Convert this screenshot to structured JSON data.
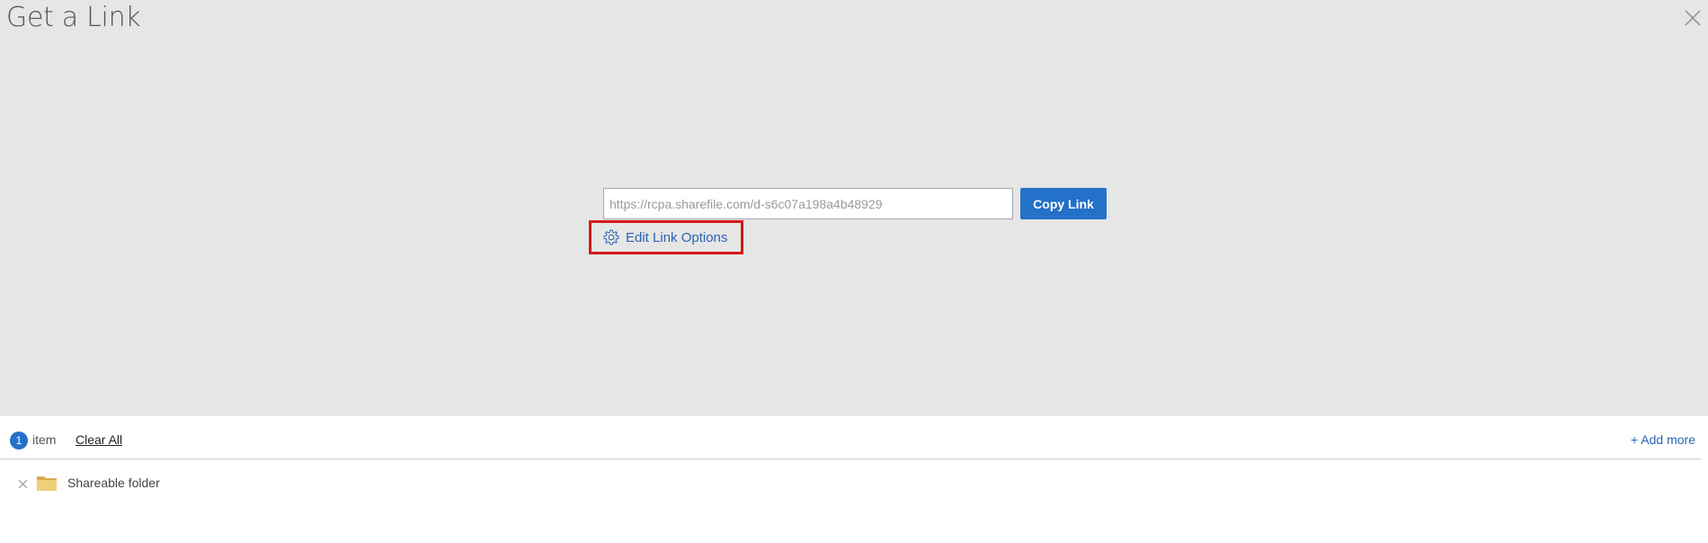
{
  "dialog": {
    "title": "Get a Link"
  },
  "link": {
    "url": "https://rcpa.sharefile.com/d-s6c07a198a4b48929",
    "copy_label": "Copy Link",
    "edit_options_label": "Edit Link Options"
  },
  "items_bar": {
    "count": "1",
    "count_label": "item",
    "clear_all_label": "Clear All",
    "add_more_label": "+ Add more"
  },
  "items": [
    {
      "name": "Shareable folder",
      "icon": "folder-icon"
    }
  ],
  "colors": {
    "accent": "#2371c8",
    "link_text": "#2a63b0",
    "highlight_border": "#d11a1a",
    "panel_bg": "#e6e6e6",
    "folder": "#e8c46a"
  }
}
